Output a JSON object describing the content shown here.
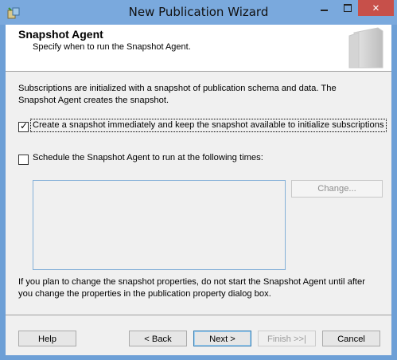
{
  "window": {
    "title": "New Publication Wizard",
    "close_glyph": "✕",
    "accent": "#7aa9dd",
    "close_color": "#c7504a"
  },
  "header": {
    "title": "Snapshot Agent",
    "subtitle": "Specify when to run the Snapshot Agent."
  },
  "content": {
    "description": "Subscriptions are initialized with a snapshot of publication schema and data. The Snapshot Agent creates the snapshot.",
    "option1": {
      "label": "Create a snapshot immediately and keep the snapshot available to initialize subscriptions",
      "checked": true,
      "mark": "✓"
    },
    "option2": {
      "label": "Schedule the Snapshot Agent to run at the following times:",
      "checked": false
    },
    "change_button": "Change...",
    "note": "If you plan to change the snapshot properties, do not start the Snapshot Agent until after you change the properties in the publication property dialog box."
  },
  "footer": {
    "help": "Help",
    "back": "< Back",
    "next": "Next >",
    "finish": "Finish >>|",
    "cancel": "Cancel"
  }
}
